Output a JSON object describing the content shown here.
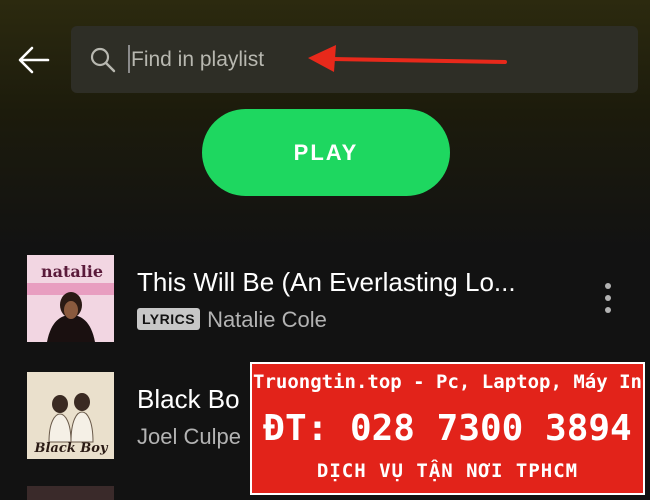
{
  "header": {
    "back_icon": "arrow-left-icon",
    "search": {
      "placeholder": "Find in playlist",
      "value": "",
      "icon": "search-icon"
    },
    "annotation_arrow_color": "#e8291b"
  },
  "play_button": {
    "label": "PLAY",
    "color": "#1ed760"
  },
  "tracks": [
    {
      "cover_text": "natalie",
      "title": "This Will Be (An Everlasting Lo...",
      "badge": "LYRICS",
      "artist": "Natalie Cole",
      "more_icon": "more-vertical-icon"
    },
    {
      "cover_text": "Black Boy",
      "title": "Black Bo",
      "artist": "Joel Culpe"
    }
  ],
  "promo": {
    "line1": "Truongtin.top - Pc, Laptop, Máy In",
    "line2": "ĐT: 028 7300 3894",
    "line3": "DỊCH VỤ TẬN NƠI TPHCM",
    "background": "#e2231a"
  }
}
